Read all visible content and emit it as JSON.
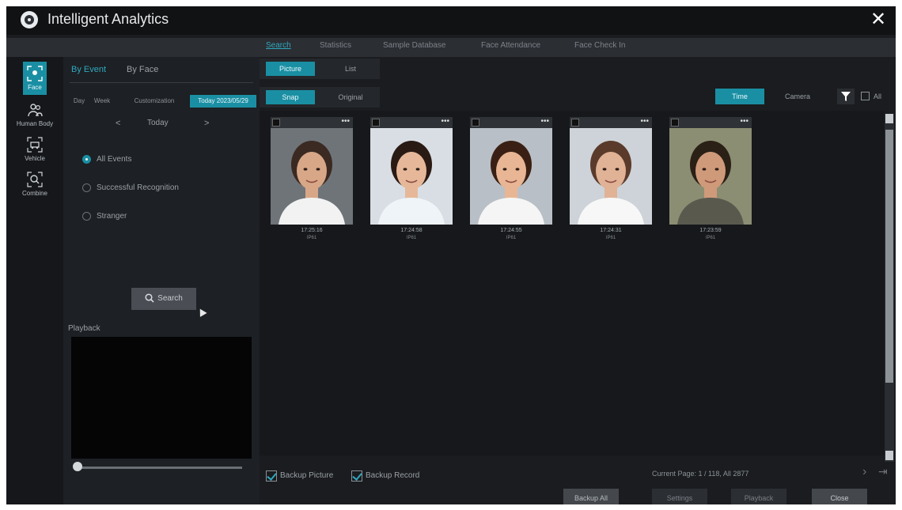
{
  "window": {
    "title": "Intelligent Analytics",
    "close_glyph": "✕"
  },
  "top_nav": [
    {
      "label": "Search",
      "active": true
    },
    {
      "label": "Statistics",
      "active": false
    },
    {
      "label": "Sample Database",
      "active": false
    },
    {
      "label": "Face Attendance",
      "active": false
    },
    {
      "label": "Face Check In",
      "active": false
    }
  ],
  "left_nav": [
    {
      "label": "Face",
      "icon": "face-icon",
      "active": true
    },
    {
      "label": "Human Body",
      "icon": "human-body-icon",
      "active": false
    },
    {
      "label": "Vehicle",
      "icon": "vehicle-icon",
      "active": false
    },
    {
      "label": "Combine",
      "icon": "combine-icon",
      "active": false
    }
  ],
  "left_panel": {
    "subtabs": [
      {
        "label": "By Event",
        "active": true
      },
      {
        "label": "By Face",
        "active": false
      }
    ],
    "range_buttons": [
      {
        "label": "Day",
        "active": false
      },
      {
        "label": "Week",
        "active": false
      },
      {
        "label": "Customization",
        "active": false
      },
      {
        "label": "Today 2023/05/29",
        "active": true
      }
    ],
    "date_nav": {
      "prev": "<",
      "label": "Today",
      "next": ">"
    },
    "event_filters": [
      {
        "label": "All Events",
        "checked": true
      },
      {
        "label": "Successful Recognition",
        "checked": false
      },
      {
        "label": "Stranger",
        "checked": false
      }
    ],
    "search_label": "Search",
    "playback_label": "Playback"
  },
  "main": {
    "view_modes": [
      {
        "label": "Picture",
        "active": true
      },
      {
        "label": "List",
        "active": false
      }
    ],
    "image_modes": [
      {
        "label": "Snap",
        "active": true
      },
      {
        "label": "Original",
        "active": false
      }
    ],
    "sort_modes": [
      {
        "label": "Time",
        "active": true
      },
      {
        "label": "Camera",
        "active": false
      }
    ],
    "all_label": "All",
    "cards": [
      {
        "time": "17:25:16",
        "type": "IP61",
        "bg": "#6f7479",
        "hair": "#3a2a22",
        "skin": "#d8a787",
        "shirt": "#f2f2f2"
      },
      {
        "time": "17:24:58",
        "type": "IP61",
        "bg": "#d8dee4",
        "hair": "#2a1a14",
        "skin": "#e6b899",
        "shirt": "#eef4f8"
      },
      {
        "time": "17:24:55",
        "type": "IP61",
        "bg": "#b9bfc6",
        "hair": "#3a2014",
        "skin": "#e8b694",
        "shirt": "#f5f5f5"
      },
      {
        "time": "17:24:31",
        "type": "IP61",
        "bg": "#cdd3d8",
        "hair": "#5a3b2b",
        "skin": "#e0b296",
        "shirt": "#f7f7f7"
      },
      {
        "time": "17:23:59",
        "type": "IP61",
        "bg": "#8b8e72",
        "hair": "#2a2016",
        "skin": "#cf9a7a",
        "shirt": "#59594e"
      }
    ],
    "backup_picture_label": "Backup Picture",
    "backup_record_label": "Backup Record",
    "page_info": "Current Page: 1 / 118, All 2877",
    "next_glyph": "›",
    "last_glyph": "⇥",
    "buttons": [
      {
        "label": "Backup All",
        "style": "primary"
      },
      {
        "label": "Settings",
        "style": "disabled"
      },
      {
        "label": "Playback",
        "style": "disabled"
      },
      {
        "label": "Close",
        "style": "close"
      }
    ]
  }
}
